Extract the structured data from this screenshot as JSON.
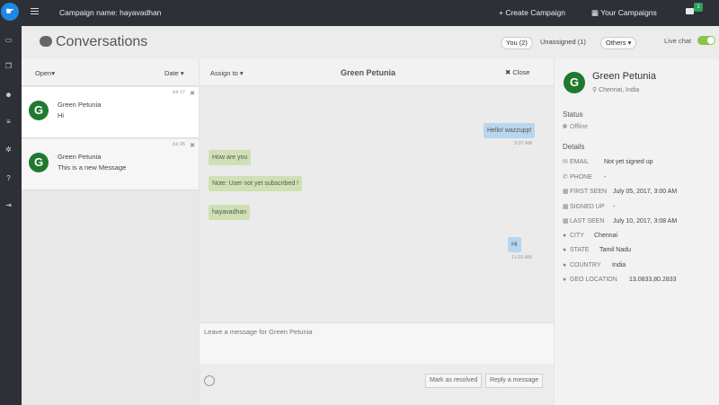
{
  "topbar": {
    "campaign_name": "Campaign name: hayavadhan",
    "create_campaign": "+ Create Campaign",
    "your_campaigns": "Your Campaigns",
    "notification_count": "1"
  },
  "header": {
    "title": "Conversations",
    "tabs": [
      {
        "label": "You (2)"
      },
      {
        "label": "Unassigned (1)"
      },
      {
        "label": "Others ▾"
      }
    ],
    "live_chat_label": "Live chat",
    "live_chat_enabled": true
  },
  "list": {
    "filter_status": "Open▾",
    "filter_sort": "Date ▾",
    "items": [
      {
        "avatar": "G",
        "name": "Green Petunia",
        "message": "Hi",
        "date": "Jul 17"
      },
      {
        "avatar": "G",
        "name": "Green Petunia",
        "message": "This is a new Message",
        "date": "Jul 05"
      }
    ]
  },
  "chat": {
    "assign_to": "Assign to ▾",
    "title": "Green Petunia",
    "close_label": "✖ Close",
    "messages": [
      {
        "text": "Hello! wazzupp!",
        "time": "3:07 AM"
      },
      {
        "text": "How are you"
      },
      {
        "text": "Note: User not yet subscribed !"
      },
      {
        "text": "hayavadhan"
      },
      {
        "text": "Hi",
        "time": "11:03 AM"
      }
    ],
    "composer_placeholder": "Leave a message for Green Petunia",
    "mark_resolved": "Mark as resolved",
    "reply": "Reply a message"
  },
  "details": {
    "avatar": "G",
    "name": "Green Petunia",
    "location": "Chennai, India",
    "status_heading": "Status",
    "status_value": "Offline",
    "details_heading": "Details",
    "fields": [
      {
        "label": "EMAIL",
        "value": "Not yet signed up"
      },
      {
        "label": "PHONE",
        "value": "-"
      },
      {
        "label": "FIRST SEEN",
        "value": "July 05, 2017, 3:00 AM"
      },
      {
        "label": "SIGNED UP",
        "value": "-"
      },
      {
        "label": "LAST SEEN",
        "value": "July 10, 2017, 3:08 AM"
      },
      {
        "label": "CITY",
        "value": "Chennai"
      },
      {
        "label": "STATE",
        "value": "Tamil Nadu"
      },
      {
        "label": "COUNTRY",
        "value": "India"
      },
      {
        "label": "GEO LOCATION",
        "value": "13.0833,80.2833"
      }
    ]
  },
  "colors": {
    "topbar": "#2d3137",
    "avatar": "#1f7a2e",
    "outgoing_bubble": "#b8d6ee",
    "incoming_bubble": "#cfe0b4",
    "toggle_on": "#8bc34a"
  }
}
